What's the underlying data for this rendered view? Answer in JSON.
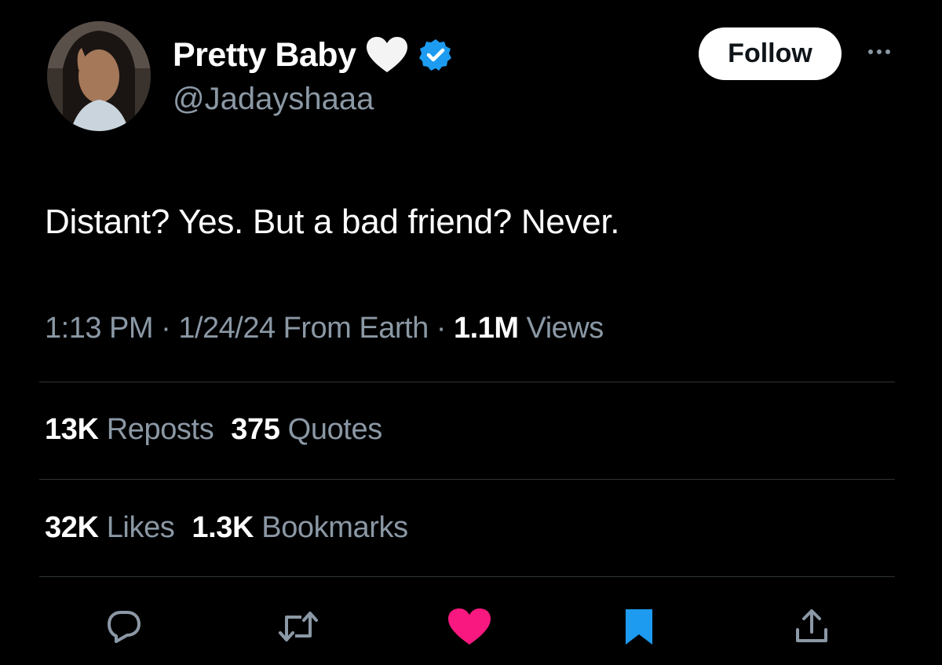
{
  "author": {
    "display_name": "Pretty Baby",
    "handle": "@Jadayshaaa",
    "verified": true,
    "name_emoji": "white-heart-icon"
  },
  "follow_label": "Follow",
  "tweet": {
    "text": "Distant? Yes. But a bad friend? Never.",
    "time": "1:13 PM",
    "date": "1/24/24",
    "source": "From Earth",
    "views_count": "1.1M",
    "views_label": "Views"
  },
  "stats": {
    "reposts_count": "13K",
    "reposts_label": "Reposts",
    "quotes_count": "375",
    "quotes_label": "Quotes",
    "likes_count": "32K",
    "likes_label": "Likes",
    "bookmarks_count": "1.3K",
    "bookmarks_label": "Bookmarks"
  },
  "actions": [
    "reply-icon",
    "repost-icon",
    "like-icon",
    "bookmark-icon",
    "share-icon"
  ],
  "colors": {
    "background": "#000000",
    "text_primary": "#ffffff",
    "text_secondary": "#8b98a5",
    "verified_blue": "#1d9bf0",
    "like_pink": "#f91880",
    "bookmark_blue": "#1d9bf0"
  }
}
